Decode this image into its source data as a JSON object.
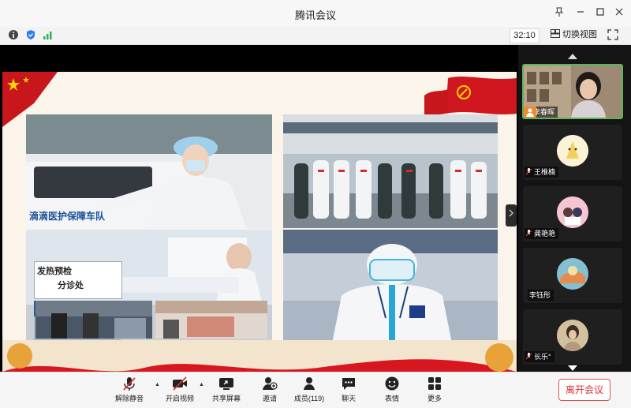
{
  "window": {
    "title": "腾讯会议"
  },
  "status": {
    "timer": "32:10",
    "switch_view": "切换视图"
  },
  "slide": {
    "photo1_text": "滴滴医护保障车队",
    "photo3_sign_line1": "发热预检",
    "photo3_sign_line2": "分诊处"
  },
  "participants": [
    {
      "name": "李春晖",
      "active": true
    },
    {
      "name": "王椎楠",
      "active": false
    },
    {
      "name": "龚艳艳",
      "active": false
    },
    {
      "name": "李钰彤",
      "active": false
    },
    {
      "name": "长乐°",
      "active": false
    }
  ],
  "toolbar": {
    "mute": "解除静音",
    "video": "开启视频",
    "share": "共享屏幕",
    "invite": "邀请",
    "members": "成员(119)",
    "chat": "聊天",
    "reactions": "表情",
    "more": "更多",
    "leave": "离开会议"
  },
  "colors": {
    "leave_red": "#e03030",
    "active_border": "#5ab55a",
    "sidebar_bg": "#141414"
  }
}
